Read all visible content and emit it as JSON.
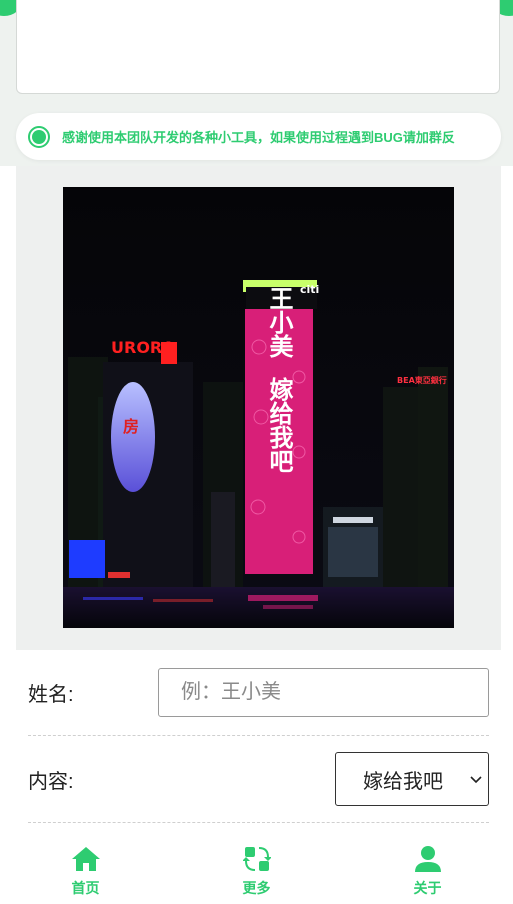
{
  "notice": {
    "text": "感谢使用本团队开发的各种小工具，如果使用过程遇到BUG请加群反"
  },
  "billboard": {
    "name": "王小美",
    "message": "嫁给我吧",
    "sign_aurora": "URORA",
    "brand_citi": "citi",
    "brand_bea": "BEA東亞銀行"
  },
  "form": {
    "name_label": "姓名:",
    "name_placeholder": "例：王小美",
    "name_value": "",
    "content_label": "内容:",
    "content_selected": "嫁给我吧"
  },
  "tabs": [
    {
      "label": "首页",
      "icon": "home-icon"
    },
    {
      "label": "更多",
      "icon": "refresh-icon"
    },
    {
      "label": "关于",
      "icon": "user-icon"
    }
  ],
  "colors": {
    "accent": "#2ecc71",
    "billboard": "#e0247a"
  }
}
